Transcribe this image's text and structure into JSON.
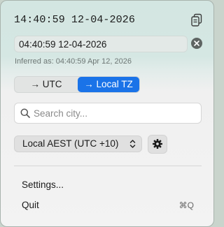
{
  "header": {
    "time_display": "14:40:59 12-04-2026"
  },
  "input": {
    "value": "04:40:59 12-04-2026"
  },
  "inferred_text": "Inferred as: 04:40:59 Apr 12, 2026",
  "toggle": {
    "utc_label": "→ UTC",
    "local_label": "→ Local TZ",
    "selected": "local"
  },
  "search": {
    "placeholder": "Search city..."
  },
  "timezone": {
    "selected": "Local AEST (UTC +10)"
  },
  "menu": {
    "settings_label": "Settings...",
    "quit_label": "Quit",
    "quit_shortcut": "⌘Q"
  },
  "colors": {
    "accent": "#1a73e8",
    "header_tint": "#d3e6e2"
  }
}
